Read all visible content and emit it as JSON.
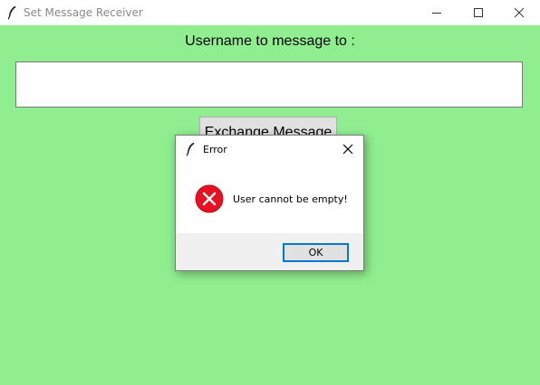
{
  "window": {
    "title": "Set Message Receiver",
    "icon": "feather-icon",
    "controls": [
      "minimize-icon",
      "maximize-icon",
      "close-icon"
    ]
  },
  "main": {
    "prompt_label": "Username to message to :",
    "username_value": "",
    "exchange_button_label": "Exchange Message",
    "background_color": "#90ee90"
  },
  "dialog": {
    "title": "Error",
    "icon": "feather-icon",
    "status_icon": "error-icon",
    "message": "User cannot be empty!",
    "ok_label": "OK",
    "accent_color": "#0078d7",
    "error_color": "#e81123"
  }
}
